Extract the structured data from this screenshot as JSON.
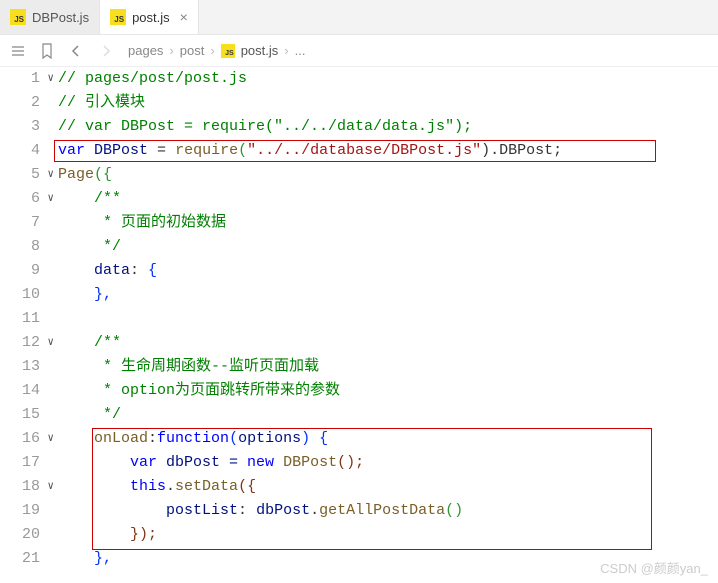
{
  "tabs": [
    {
      "label": "DBPost.js",
      "active": false
    },
    {
      "label": "post.js",
      "active": true
    }
  ],
  "breadcrumb": {
    "seg1": "pages",
    "seg2": "post",
    "seg3": "post.js",
    "ellipsis": "..."
  },
  "gutter": [
    "1",
    "2",
    "3",
    "4",
    "5",
    "6",
    "7",
    "8",
    "9",
    "10",
    "11",
    "12",
    "13",
    "14",
    "15",
    "16",
    "17",
    "18",
    "19",
    "20",
    "21"
  ],
  "code": {
    "l1_comment": "// pages/post/post.js",
    "l2_comment": "// 引入模块",
    "l3_comment": "// var DBPost = require(\"../../data/data.js\");",
    "l4": {
      "var": "var",
      "name": "DBPost",
      "eq": " = ",
      "req": "require",
      "str": "\"../../database/DBPost.js\"",
      "tail": ").DBPost;"
    },
    "l5": {
      "page": "Page",
      "open": "({"
    },
    "l6_open": "    /**",
    "l7_body": "     * 页面的初始数据",
    "l8_close": "     */",
    "l9": {
      "indent": "    ",
      "key": "data",
      "colon": ": ",
      "brace": "{"
    },
    "l10": "    },",
    "l11": "",
    "l12_open": "    /**",
    "l13_body": "     * 生命周期函数--监听页面加载",
    "l14_body": "     * option为页面跳转所带来的参数",
    "l15_close": "     */",
    "l16": {
      "indent": "    ",
      "key": "onLoad",
      "colon": ":",
      "fn": "function",
      "open": "(",
      "param": "options",
      "close": ") {"
    },
    "l17": {
      "indent": "        ",
      "var": "var",
      "name": " dbPost = ",
      "new": "new",
      "ctor": " DBPost",
      "call": "();"
    },
    "l18": {
      "indent": "        ",
      "this": "this",
      "dot": ".",
      "method": "setData",
      "open": "({"
    },
    "l19": {
      "indent": "            ",
      "key": "postList",
      "colon": ": ",
      "obj": "dbPost",
      "dot": ".",
      "method": "getAllPostData",
      "call": "()"
    },
    "l20": "        });",
    "l21": "    },"
  },
  "watermark": "CSDN @颜颜yan_"
}
